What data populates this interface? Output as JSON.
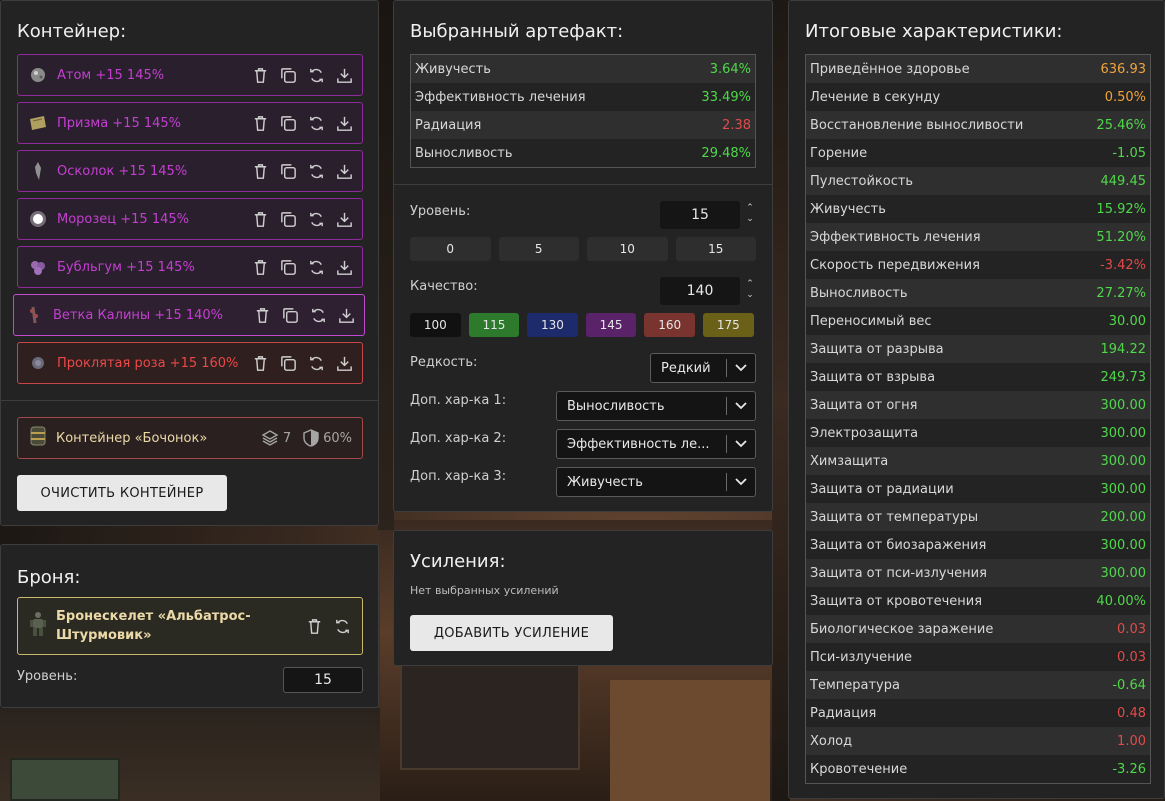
{
  "colors": {
    "green": "#4fd84a",
    "red": "#e24a4a",
    "gold": "#f0a43a",
    "purple": "#c43fd1",
    "chip_115": "#2d7a2d",
    "chip_130": "#1d2a6b",
    "chip_145": "#5a2268",
    "chip_160": "#7a3430",
    "chip_175": "#6b6018"
  },
  "container": {
    "title": "Контейнер:",
    "items": [
      {
        "name": "Атом +15 145%",
        "icon": "atom-artifact-icon"
      },
      {
        "name": "Призма +15 145%",
        "icon": "prism-artifact-icon"
      },
      {
        "name": "Осколок +15 145%",
        "icon": "shard-artifact-icon"
      },
      {
        "name": "Морозец +15 145%",
        "icon": "frost-artifact-icon"
      },
      {
        "name": "Бубльгум +15 145%",
        "icon": "bubblegum-artifact-icon"
      },
      {
        "name": "Ветка Калины +15 140%",
        "icon": "viburnum-branch-artifact-icon"
      },
      {
        "name": "Проклятая роза +15 160%",
        "icon": "cursed-rose-artifact-icon"
      }
    ],
    "barrel": {
      "name": "Контейнер «Бочонок»",
      "slots": "7",
      "protection": "60%"
    },
    "clear_button": "ОЧИСТИТЬ КОНТЕЙНЕР"
  },
  "armor": {
    "title": "Броня:",
    "name": "Бронескелет «Альбатрос-Штурмовик»",
    "level_label": "Уровень:",
    "level_value": "15"
  },
  "artifact": {
    "title": "Выбранный артефакт:",
    "stats": [
      {
        "name": "Живучесть",
        "value": "3.64%",
        "color": "green"
      },
      {
        "name": "Эффективность лечения",
        "value": "33.49%",
        "color": "green"
      },
      {
        "name": "Радиация",
        "value": "2.38",
        "color": "red"
      },
      {
        "name": "Выносливость",
        "value": "29.48%",
        "color": "green"
      }
    ],
    "level_label": "Уровень:",
    "level_value": "15",
    "level_presets": [
      "0",
      "5",
      "10",
      "15"
    ],
    "quality_label": "Качество:",
    "quality_value": "140",
    "quality_presets": [
      "100",
      "115",
      "130",
      "145",
      "160",
      "175"
    ],
    "rarity_label": "Редкость:",
    "rarity_value": "Редкий",
    "extra1_label": "Доп. хар-ка 1:",
    "extra1_value": "Выносливость",
    "extra2_label": "Доп. хар-ка 2:",
    "extra2_value": "Эффективность ле...",
    "extra3_label": "Доп. хар-ка 3:",
    "extra3_value": "Живучесть"
  },
  "boosts": {
    "title": "Усиления:",
    "empty_text": "Нет выбранных усилений",
    "add_button": "ДОБАВИТЬ УСИЛЕНИЕ"
  },
  "totals": {
    "title": "Итоговые характеристики:",
    "rows": [
      {
        "name": "Приведённое здоровье",
        "value": "636.93",
        "color": "gold"
      },
      {
        "name": "Лечение в секунду",
        "value": "0.50%",
        "color": "gold"
      },
      {
        "name": "Восстановление выносливости",
        "value": "25.46%",
        "color": "green"
      },
      {
        "name": "Горение",
        "value": "-1.05",
        "color": "green"
      },
      {
        "name": "Пулестойкость",
        "value": "449.45",
        "color": "green"
      },
      {
        "name": "Живучесть",
        "value": "15.92%",
        "color": "green"
      },
      {
        "name": "Эффективность лечения",
        "value": "51.20%",
        "color": "green"
      },
      {
        "name": "Скорость передвижения",
        "value": "-3.42%",
        "color": "red"
      },
      {
        "name": "Выносливость",
        "value": "27.27%",
        "color": "green"
      },
      {
        "name": "Переносимый вес",
        "value": "30.00",
        "color": "green"
      },
      {
        "name": "Защита от разрыва",
        "value": "194.22",
        "color": "green"
      },
      {
        "name": "Защита от взрыва",
        "value": "249.73",
        "color": "green"
      },
      {
        "name": "Защита от огня",
        "value": "300.00",
        "color": "green"
      },
      {
        "name": "Электрозащита",
        "value": "300.00",
        "color": "green"
      },
      {
        "name": "Химзащита",
        "value": "300.00",
        "color": "green"
      },
      {
        "name": "Защита от радиации",
        "value": "300.00",
        "color": "green"
      },
      {
        "name": "Защита от температуры",
        "value": "200.00",
        "color": "green"
      },
      {
        "name": "Защита от биозаражения",
        "value": "300.00",
        "color": "green"
      },
      {
        "name": "Защита от пси-излучения",
        "value": "300.00",
        "color": "green"
      },
      {
        "name": "Защита от кровотечения",
        "value": "40.00%",
        "color": "green"
      },
      {
        "name": "Биологическое заражение",
        "value": "0.03",
        "color": "red"
      },
      {
        "name": "Пси-излучение",
        "value": "0.03",
        "color": "red"
      },
      {
        "name": "Температура",
        "value": "-0.64",
        "color": "green"
      },
      {
        "name": "Радиация",
        "value": "0.48",
        "color": "red"
      },
      {
        "name": "Холод",
        "value": "1.00",
        "color": "red"
      },
      {
        "name": "Кровотечение",
        "value": "-3.26",
        "color": "green"
      }
    ]
  }
}
